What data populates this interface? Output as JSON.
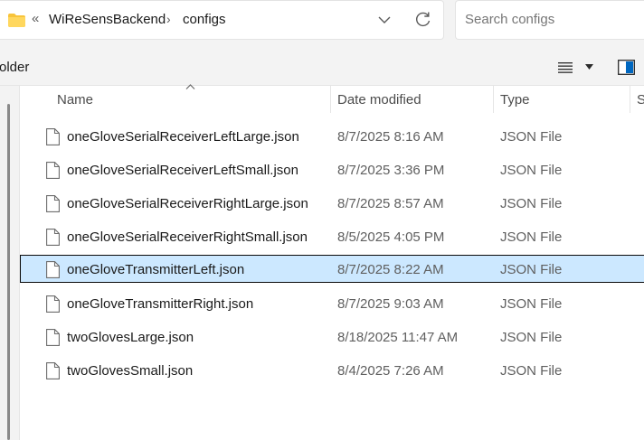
{
  "address": {
    "overflow_glyph": "«",
    "breadcrumbs": [
      "WiReSensBackend",
      "configs"
    ],
    "separator": "›"
  },
  "search": {
    "placeholder": "Search configs"
  },
  "command_bar": {
    "partial_label": "older"
  },
  "columns": {
    "name": "Name",
    "date": "Date modified",
    "type": "Type",
    "size_partial": "S"
  },
  "files": [
    {
      "name": "oneGloveSerialReceiverLeftLarge.json",
      "date": "8/7/2025 8:16 AM",
      "type": "JSON File",
      "selected": false
    },
    {
      "name": "oneGloveSerialReceiverLeftSmall.json",
      "date": "8/7/2025 3:36 PM",
      "type": "JSON File",
      "selected": false
    },
    {
      "name": "oneGloveSerialReceiverRightLarge.json",
      "date": "8/7/2025 8:57 AM",
      "type": "JSON File",
      "selected": false
    },
    {
      "name": "oneGloveSerialReceiverRightSmall.json",
      "date": "8/5/2025 4:05 PM",
      "type": "JSON File",
      "selected": false
    },
    {
      "name": "oneGloveTransmitterLeft.json",
      "date": "8/7/2025 8:22 AM",
      "type": "JSON File",
      "selected": true
    },
    {
      "name": "oneGloveTransmitterRight.json",
      "date": "8/7/2025 9:03 AM",
      "type": "JSON File",
      "selected": false
    },
    {
      "name": "twoGlovesLarge.json",
      "date": "8/18/2025 11:47 AM",
      "type": "JSON File",
      "selected": false
    },
    {
      "name": "twoGlovesSmall.json",
      "date": "8/4/2025 7:26 AM",
      "type": "JSON File",
      "selected": false
    }
  ],
  "colors": {
    "selection_fill": "#cce8ff",
    "folder_yellow": "#f8c43a",
    "chrome_bg": "#f3f3f3",
    "pane_toggle_blue": "#0067c0"
  },
  "icons": {
    "folder": "folder-icon",
    "refresh": "refresh-icon",
    "dropdown": "chevron-down-icon",
    "file": "file-icon",
    "view": "list-view-icon",
    "pane": "details-pane-icon"
  }
}
